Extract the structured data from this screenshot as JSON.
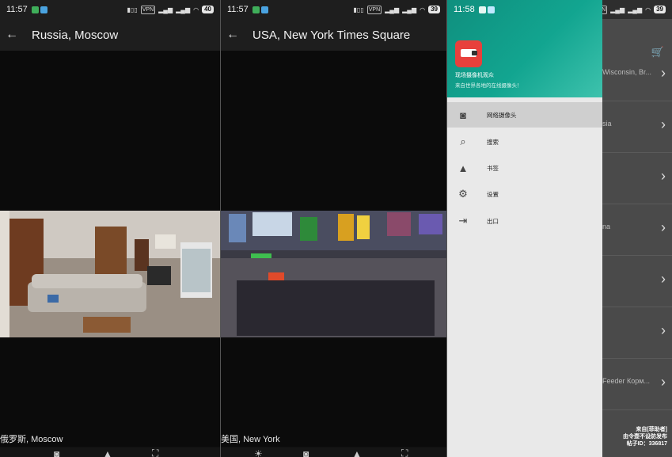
{
  "panels": [
    {
      "status": {
        "time": "11:57",
        "battery": "40"
      },
      "title": "Russia, Moscow",
      "caption": "俄罗斯, Moscow"
    },
    {
      "status": {
        "time": "11:57",
        "battery": "39"
      },
      "title": "USA, New York Times Square",
      "caption": "美国, New York"
    }
  ],
  "drawer": {
    "status": {
      "time": "11:58",
      "battery": "39"
    },
    "app_title": "现场摄像机观众",
    "app_subtitle": "来自世界各地的在线摄像头！",
    "menu": [
      {
        "label": "网络摄像头",
        "icon": "camera-icon",
        "active": true
      },
      {
        "label": "搜索",
        "icon": "search-icon",
        "active": false
      },
      {
        "label": "书签",
        "icon": "thumbs-up-icon",
        "active": false
      },
      {
        "label": "设置",
        "icon": "gear-icon",
        "active": false
      },
      {
        "label": "出口",
        "icon": "exit-icon",
        "active": false
      }
    ],
    "background_list": [
      "Wisconsin, Br...",
      "sia",
      "",
      "na",
      "",
      "",
      "Feeder Корм..."
    ]
  },
  "status_tags": {
    "vpn": "VPN"
  },
  "watermark": [
    "来自[菲助者]",
    "由令壶不设防发布",
    "帖子ID：336817"
  ],
  "colors": {
    "accent": "#12a590",
    "logo": "#e8403c"
  }
}
